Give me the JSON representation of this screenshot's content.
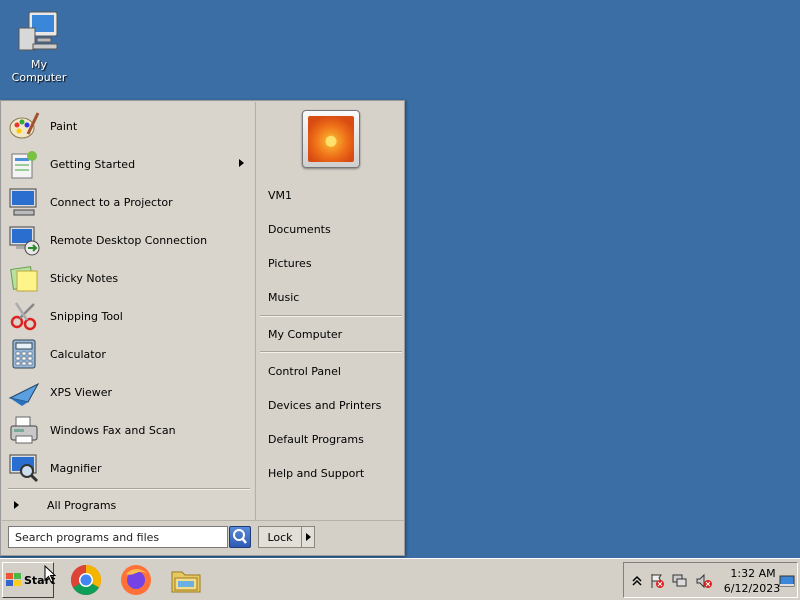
{
  "desktop": {
    "icons": [
      {
        "label": "My Computer",
        "icon": "computer-icon"
      }
    ]
  },
  "start_menu": {
    "programs": [
      {
        "label": "Paint",
        "icon": "paint-icon"
      },
      {
        "label": "Getting Started",
        "icon": "getting-started-icon",
        "has_submenu": true
      },
      {
        "label": "Connect to a Projector",
        "icon": "projector-icon"
      },
      {
        "label": "Remote Desktop Connection",
        "icon": "remote-desktop-icon"
      },
      {
        "label": "Sticky Notes",
        "icon": "sticky-notes-icon"
      },
      {
        "label": "Snipping Tool",
        "icon": "scissors-icon"
      },
      {
        "label": "Calculator",
        "icon": "calculator-icon"
      },
      {
        "label": "XPS Viewer",
        "icon": "xps-viewer-icon"
      },
      {
        "label": "Windows Fax and Scan",
        "icon": "fax-icon"
      },
      {
        "label": "Magnifier",
        "icon": "magnifier-icon"
      }
    ],
    "all_programs_label": "All Programs",
    "search_placeholder": "Search programs and files",
    "lock_label": "Lock",
    "right_items": {
      "user": "VM1",
      "documents": "Documents",
      "pictures": "Pictures",
      "music": "Music",
      "my_computer": "My Computer",
      "control_panel": "Control Panel",
      "devices": "Devices and Printers",
      "default_programs": "Default Programs",
      "help": "Help and Support"
    }
  },
  "taskbar": {
    "start_label": "Start",
    "pinned": [
      {
        "name": "Google Chrome",
        "icon": "chrome-icon"
      },
      {
        "name": "Firefox",
        "icon": "firefox-icon"
      },
      {
        "name": "Windows Explorer",
        "icon": "folder-icon"
      }
    ],
    "tray": {
      "time": "1:32 AM",
      "date": "6/12/2023",
      "icons": [
        "show-hidden-icons-icon",
        "action-center-flag-icon",
        "network-icon",
        "volume-muted-icon",
        "show-desktop-icon"
      ]
    }
  },
  "colors": {
    "desktop_background": "#3a6ea5",
    "menu_background": "#d4d0c8"
  }
}
